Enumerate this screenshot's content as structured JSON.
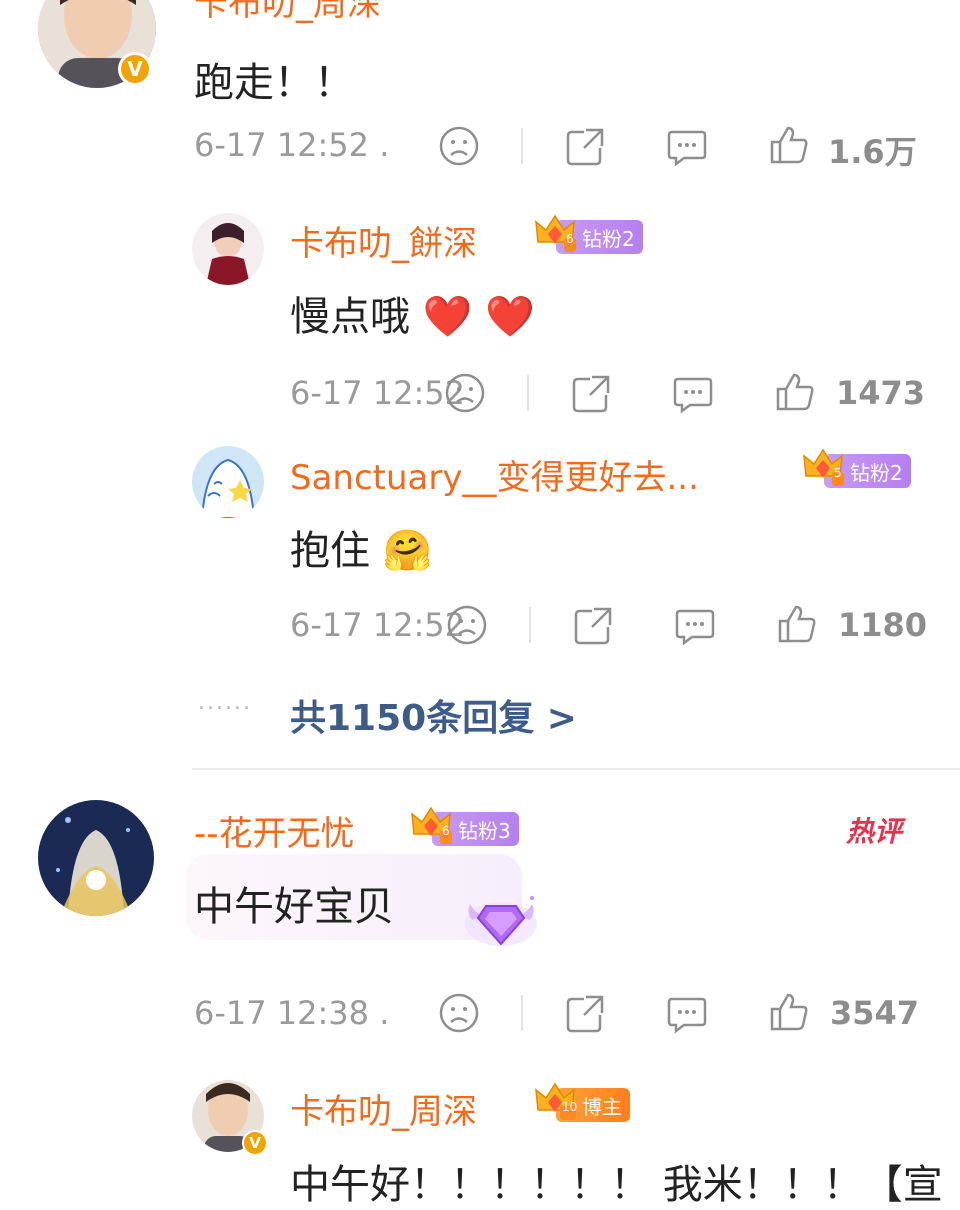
{
  "top_comment": {
    "username": "卡布叻_周深",
    "text": "跑走！！",
    "time": "6-17 12:52",
    "time_suffix": ".",
    "like_count": "1.6万",
    "replies": [
      {
        "username": "卡布叻_餅深",
        "badge_level": "6",
        "badge_label": "钻粉2",
        "text": "慢点哦",
        "emojis": "❤️ ❤️",
        "time": "6-17 12:52",
        "like_count": "1473"
      },
      {
        "username": "Sanctuary__变得更好去...",
        "badge_level": "5",
        "badge_label": "钻粉2",
        "text": "抱住",
        "emojis": "🤗",
        "time": "6-17 12:52",
        "like_count": "1180"
      }
    ],
    "more_replies_label": "共1150条回复 >",
    "dots": "......"
  },
  "second_comment": {
    "username": "--花开无忧",
    "badge_level": "6",
    "badge_label": "钻粉3",
    "hot_label": "热评",
    "text": "中午好宝贝",
    "time": "6-17 12:38",
    "time_suffix": ".",
    "like_count": "3547",
    "reply": {
      "username": "卡布叻_周深",
      "badge_level": "10",
      "badge_label": "博主",
      "text": "中午好！！！！！！ 我米！！！【宣"
    }
  },
  "colors": {
    "username": "#f26b1d",
    "meta": "#9a9a9a",
    "link": "#3f5b87",
    "hot": "#e8324c",
    "verified": "#f3a300"
  },
  "icons": [
    "sad-face-icon",
    "share-icon",
    "comment-icon",
    "like-icon",
    "verified-icon",
    "crown-icon",
    "diamond-icon"
  ]
}
